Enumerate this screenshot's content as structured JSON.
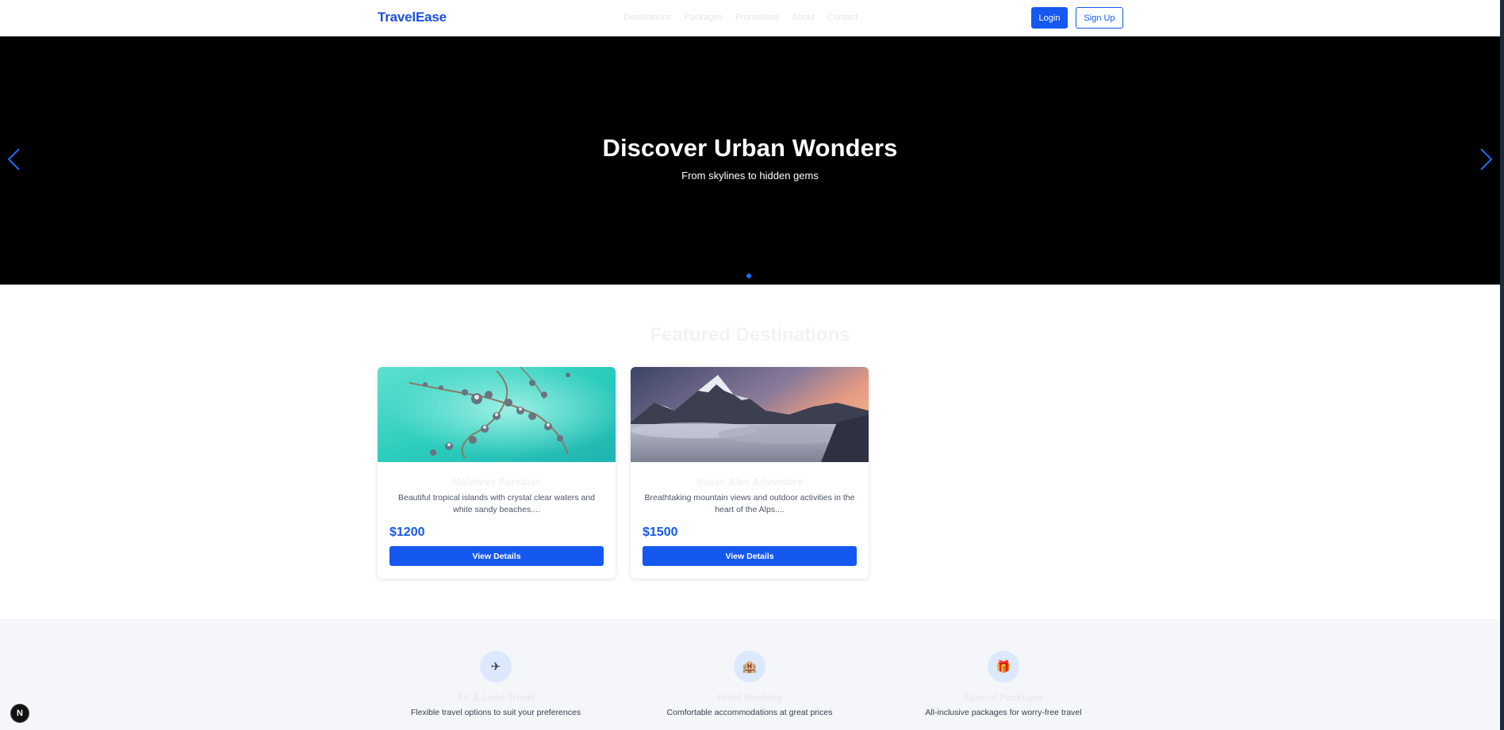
{
  "header": {
    "logo": "TravelEase",
    "nav": [
      "Destinations",
      "Packages",
      "Promotions",
      "About",
      "Contact"
    ],
    "login_label": "Login",
    "signup_label": "Sign Up"
  },
  "hero": {
    "title": "Discover Urban Wonders",
    "subtitle": "From skylines to hidden gems",
    "slide_count": 1,
    "active_slide": 1,
    "arrow_color": "#1d6df2"
  },
  "featured": {
    "title": "Featured Destinations",
    "cards": [
      {
        "title": "Maldives Paradise",
        "description": "Beautiful tropical islands with crystal clear waters and white sandy beaches....",
        "price": "$1200",
        "button_label": "View Details",
        "image": "tropical-overwater-villas"
      },
      {
        "title": "Swiss Alps Adventure",
        "description": "Breathtaking mountain views and outdoor activities in the heart of the Alps....",
        "price": "$1500",
        "button_label": "View Details",
        "image": "snowy-mountains-sunset"
      }
    ]
  },
  "features": [
    {
      "icon": "plane-icon",
      "glyph": "✈",
      "title": "Air & Land Travel",
      "description": "Flexible travel options to suit your preferences"
    },
    {
      "icon": "hotel-icon",
      "glyph": "🏨",
      "title": "Hotel Booking",
      "description": "Comfortable accommodations at great prices"
    },
    {
      "icon": "gift-icon",
      "glyph": "🎁",
      "title": "Special Packages",
      "description": "All-inclusive packages for worry-free travel"
    }
  ],
  "badge": {
    "letter": "N"
  },
  "colors": {
    "accent": "#1558f0",
    "hero_bg": "#000000",
    "features_bg": "#f4f6f9"
  }
}
